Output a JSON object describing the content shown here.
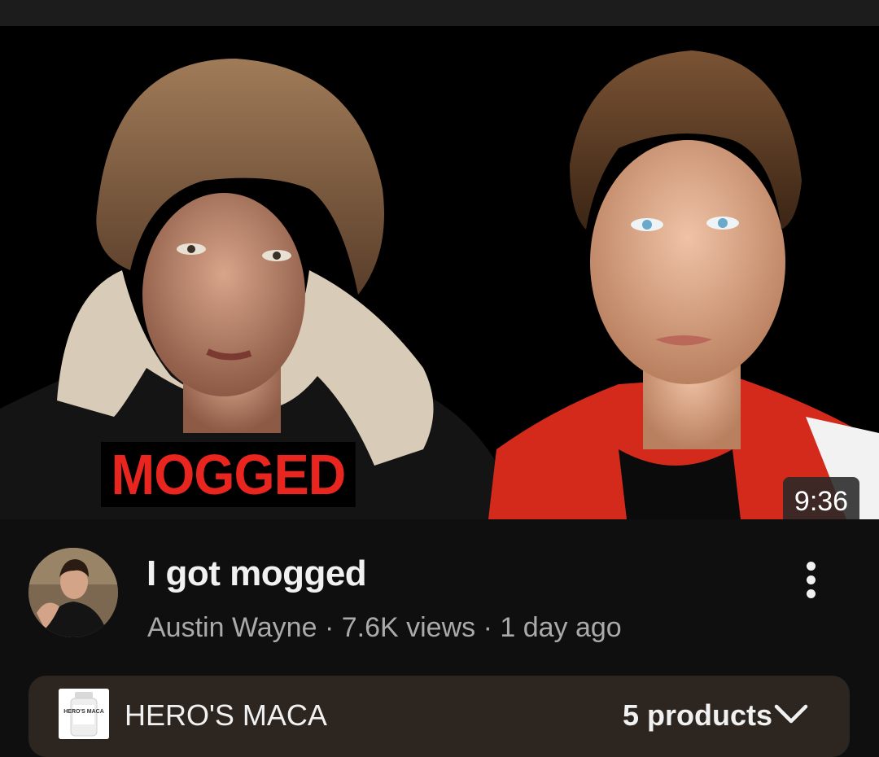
{
  "thumbnail": {
    "overlay_text": "MOGGED",
    "duration": "9:36"
  },
  "video": {
    "title": "I got mogged",
    "meta": "Austin Wayne · 7.6K views · 1 day ago"
  },
  "products": {
    "brand": "HERO'S MACA",
    "bottle_label": "HERO'S MACA",
    "count_label": "5 products",
    "expand_icon": "chevron-down-icon"
  },
  "menu": {
    "icon": "more-vert-icon"
  },
  "colors": {
    "background": "#0f0f0f",
    "overlay_red": "#e8261f",
    "products_bar": "#2d2620",
    "meta_text": "#aaaaaa"
  }
}
